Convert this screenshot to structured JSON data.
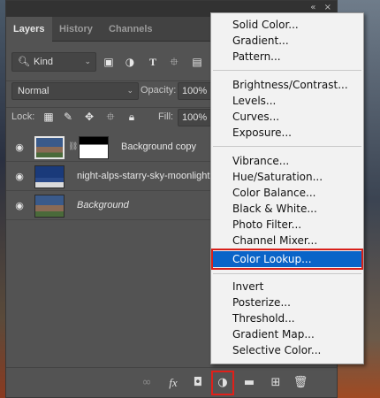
{
  "panel": {
    "window_buttons": [
      "«",
      "×"
    ],
    "tabs": [
      {
        "label": "Layers",
        "active": true
      },
      {
        "label": "History",
        "active": false
      },
      {
        "label": "Channels",
        "active": false
      }
    ],
    "filter": {
      "kind_label": "Kind",
      "icons": [
        "image-filter-icon",
        "adjustment-filter-icon",
        "type-filter-icon",
        "shape-filter-icon",
        "smart-object-filter-icon"
      ]
    },
    "blend_mode": "Normal",
    "opacity_label": "Opacity:",
    "opacity_value": "100%",
    "lock_label": "Lock:",
    "fill_label": "Fill:",
    "fill_value": "100%",
    "layers": [
      {
        "name": "Background copy",
        "italic": false,
        "selected": true,
        "has_mask": true
      },
      {
        "name": "night-alps-starry-sky-moonlight",
        "italic": false,
        "selected": false,
        "has_mask": false
      },
      {
        "name": "Background",
        "italic": true,
        "selected": false,
        "has_mask": false
      }
    ],
    "bottom_icons": [
      "link-layers-icon",
      "fx-icon",
      "add-mask-icon",
      "adjustment-layer-icon",
      "new-group-icon",
      "new-layer-icon",
      "delete-icon"
    ]
  },
  "menu": {
    "items": [
      "Solid Color...",
      "Gradient...",
      "Pattern...",
      "Brightness/Contrast...",
      "Levels...",
      "Curves...",
      "Exposure...",
      "Vibrance...",
      "Hue/Saturation...",
      "Color Balance...",
      "Black & White...",
      "Photo Filter...",
      "Channel Mixer...",
      "Color Lookup...",
      "Invert",
      "Posterize...",
      "Threshold...",
      "Gradient Map...",
      "Selective Color..."
    ],
    "highlighted": "Color Lookup...",
    "highlight_color": "#0a64c8",
    "outline_color": "#d8201a"
  }
}
